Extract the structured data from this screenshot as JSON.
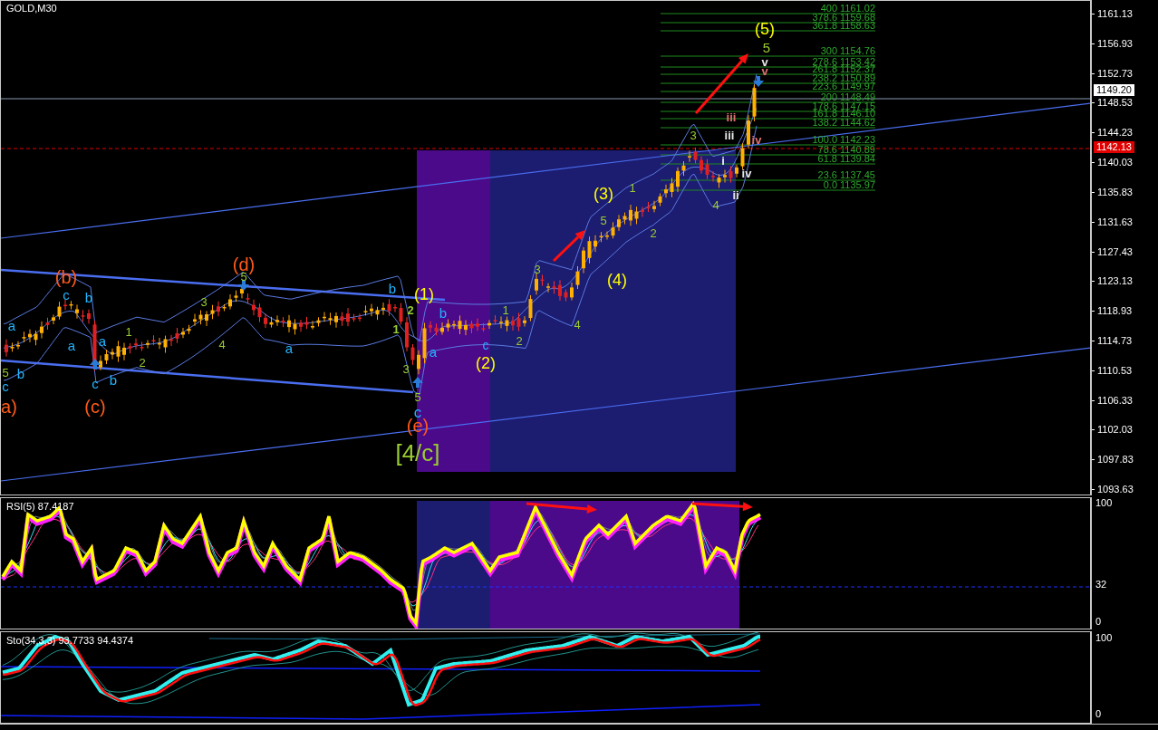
{
  "window": {
    "title": "GOLD,M30"
  },
  "main_chart": {
    "price_axis": [
      "1161.13",
      "1156.93",
      "1152.73",
      "1148.53",
      "1144.23",
      "1140.03",
      "1135.83",
      "1131.63",
      "1127.43",
      "1123.13",
      "1118.93",
      "1114.73",
      "1110.53",
      "1106.33",
      "1102.03",
      "1097.83",
      "1093.63"
    ],
    "price_markers": [
      {
        "kind": "bid",
        "label": "1149.20"
      },
      {
        "kind": "alert",
        "label": "1142.13"
      }
    ],
    "fib_levels": [
      {
        "label": "400 1161.02"
      },
      {
        "label": "378.6 1159.68"
      },
      {
        "label": "361.8 1158.63"
      },
      {
        "label": "300 1154.76"
      },
      {
        "label": "278.6 1153.42"
      },
      {
        "label": "261.8 1152.37"
      },
      {
        "label": "238.2 1150.89"
      },
      {
        "label": "223.6 1149.97"
      },
      {
        "label": "200 1148.49"
      },
      {
        "label": "178.6 1147.15"
      },
      {
        "label": "161.8 1146.10"
      },
      {
        "label": "138.2 1144.62"
      },
      {
        "label": "100.0 1142.23"
      },
      {
        "label": "78.6 1140.89"
      },
      {
        "label": "61.8 1139.84"
      },
      {
        "label": "23.6 1137.45"
      },
      {
        "label": "0.0 1135.97"
      }
    ],
    "wave_labels": [
      {
        "text": "(b)",
        "color": "#ff5a1a"
      },
      {
        "text": "c",
        "color": "#22b4ff"
      },
      {
        "text": "b",
        "color": "#22b4ff"
      },
      {
        "text": "a",
        "color": "#22b4ff"
      },
      {
        "text": "a",
        "color": "#22b4ff"
      },
      {
        "text": "a",
        "color": "#22b4ff"
      },
      {
        "text": "5",
        "color": "#9acd32"
      },
      {
        "text": "b",
        "color": "#22b4ff"
      },
      {
        "text": "c",
        "color": "#22b4ff"
      },
      {
        "text": "a)",
        "color": "#ff5a1a"
      },
      {
        "text": "c",
        "color": "#22b4ff"
      },
      {
        "text": "b",
        "color": "#22b4ff"
      },
      {
        "text": "(c)",
        "color": "#ff5a1a"
      },
      {
        "text": "1",
        "color": "#9acd32"
      },
      {
        "text": "2",
        "color": "#9acd32"
      },
      {
        "text": "(d)",
        "color": "#ff5a1a"
      },
      {
        "text": "5",
        "color": "#9acd32"
      },
      {
        "text": "3",
        "color": "#9acd32"
      },
      {
        "text": "4",
        "color": "#9acd32"
      },
      {
        "text": "a",
        "color": "#22b4ff"
      },
      {
        "text": "b",
        "color": "#22b4ff"
      },
      {
        "text": "(1)",
        "color": "#ffff00"
      },
      {
        "text": "1",
        "color": "#9acd32"
      },
      {
        "text": "2",
        "color": "#9acd32"
      },
      {
        "text": "b",
        "color": "#22b4ff"
      },
      {
        "text": "a",
        "color": "#22b4ff"
      },
      {
        "text": "3",
        "color": "#9acd32"
      },
      {
        "text": "5",
        "color": "#9acd32"
      },
      {
        "text": "c",
        "color": "#22b4ff"
      },
      {
        "text": "(e)",
        "color": "#ff5a1a"
      },
      {
        "text": "[4/c]",
        "color": "#9acd32"
      },
      {
        "text": "c",
        "color": "#22b4ff"
      },
      {
        "text": "(2)",
        "color": "#ffff00"
      },
      {
        "text": "1",
        "color": "#9acd32"
      },
      {
        "text": "2",
        "color": "#9acd32"
      },
      {
        "text": "3",
        "color": "#9acd32"
      },
      {
        "text": "4",
        "color": "#9acd32"
      },
      {
        "text": "(3)",
        "color": "#ffff00"
      },
      {
        "text": "5",
        "color": "#9acd32"
      },
      {
        "text": "1",
        "color": "#9acd32"
      },
      {
        "text": "(4)",
        "color": "#ffff00"
      },
      {
        "text": "2",
        "color": "#9acd32"
      },
      {
        "text": "3",
        "color": "#9acd32"
      },
      {
        "text": "4",
        "color": "#9acd32"
      },
      {
        "text": "iii",
        "color": "#e8e8e8"
      },
      {
        "text": "i",
        "color": "#e8e8e8"
      },
      {
        "text": "iv",
        "color": "#e8e8e8"
      },
      {
        "text": "ii",
        "color": "#e8e8e8"
      },
      {
        "text": "iii",
        "color": "#e07070"
      },
      {
        "text": "iv",
        "color": "#e07070"
      },
      {
        "text": "(5)",
        "color": "#ffff00"
      },
      {
        "text": "5",
        "color": "#9acd32"
      },
      {
        "text": "v",
        "color": "#e8e8e8"
      },
      {
        "text": "v",
        "color": "#e07070"
      }
    ]
  },
  "rsi_panel": {
    "label": "RSI(5) 87.4187",
    "axis": [
      "100",
      "32",
      "0"
    ]
  },
  "stochastic_panel": {
    "label": "Sto(34,3,3) 93.7733 94.4374",
    "axis": [
      "100",
      "0"
    ]
  }
}
